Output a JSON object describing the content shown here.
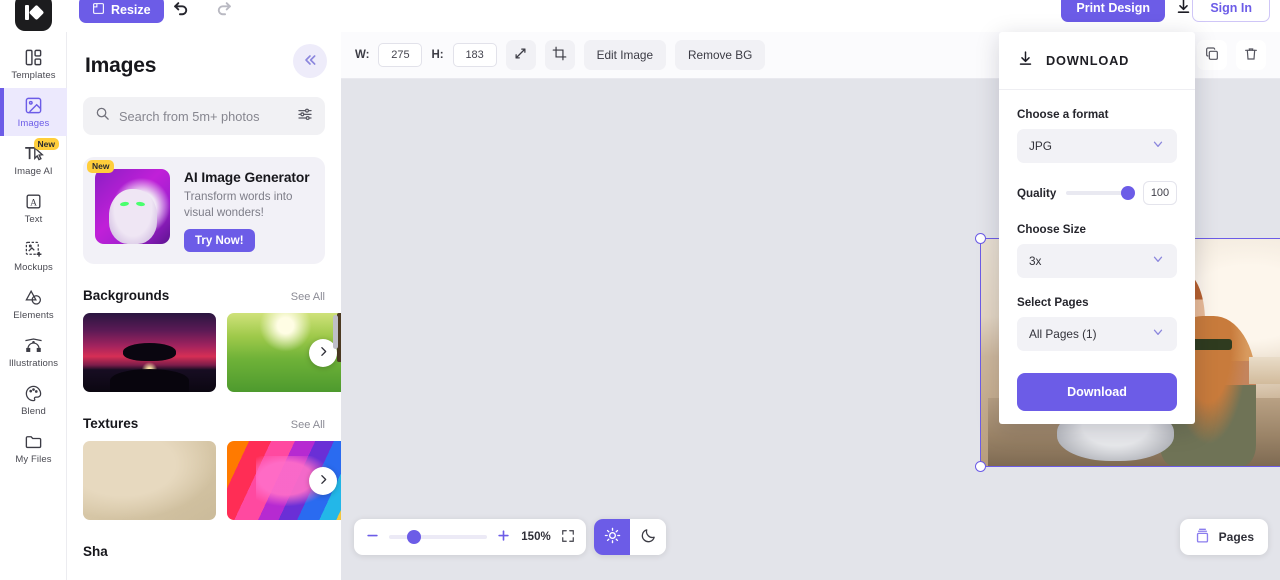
{
  "header": {
    "logo_name": "app-logo",
    "resize_label": "Resize",
    "undo_icon": "undo-arrow-icon",
    "redo_icon": "redo-arrow-icon",
    "print_label": "Print Design",
    "download_icon": "download-icon",
    "signin_label": "Sign In"
  },
  "rail": {
    "items": [
      {
        "label": "Templates",
        "icon": "templates-grid-icon",
        "active": false,
        "badge": ""
      },
      {
        "label": "Images",
        "icon": "image-photo-icon",
        "active": true,
        "badge": ""
      },
      {
        "label": "Image AI",
        "icon": "text-cursor-ai-icon",
        "active": false,
        "badge": "New"
      },
      {
        "label": "Text",
        "icon": "letter-a-box-icon",
        "active": false,
        "badge": ""
      },
      {
        "label": "Mockups",
        "icon": "mockup-frame-icon",
        "active": false,
        "badge": ""
      },
      {
        "label": "Elements",
        "icon": "elements-shape-icon",
        "active": false,
        "badge": ""
      },
      {
        "label": "Illustrations",
        "icon": "illustration-nodes-icon",
        "active": false,
        "badge": ""
      },
      {
        "label": "Blend",
        "icon": "palette-icon",
        "active": false,
        "badge": ""
      },
      {
        "label": "My Files",
        "icon": "folder-icon",
        "active": false,
        "badge": ""
      }
    ]
  },
  "panel": {
    "title": "Images",
    "collapse_icon": "chevron-double-left-icon",
    "search": {
      "placeholder": "Search from 5m+ photos",
      "value": "",
      "search_icon": "search-icon",
      "filter_icon": "sliders-filter-icon"
    },
    "promo": {
      "badge": "New",
      "title": "AI Image Generator",
      "subtitle": "Transform words into visual wonders!",
      "cta": "Try Now!",
      "thumb_name": "ai-monster-thumbnail"
    },
    "sections": [
      {
        "title": "Backgrounds",
        "see_all": "See All",
        "tiles": [
          "sunset-tree-silhouette",
          "sunlit-green-meadow"
        ]
      },
      {
        "title": "Textures",
        "see_all": "See All",
        "tiles": [
          "beige-paper-texture",
          "rainbow-paint-strokes"
        ]
      }
    ],
    "cut_section_title": "Sha"
  },
  "toolbar": {
    "width_label": "W:",
    "width_value": "275",
    "height_label": "H:",
    "height_value": "183",
    "resize_icon": "scale-diagonal-icon",
    "crop_icon": "crop-icon",
    "edit_image_label": "Edit Image",
    "remove_bg_label": "Remove BG",
    "position_icon": "position-grid-icon",
    "duplicate_icon": "duplicate-copy-icon",
    "delete_icon": "trash-delete-icon"
  },
  "canvas": {
    "selected_object": "group-beach-selfie-photo"
  },
  "download_panel": {
    "header_icon": "download-icon",
    "header_title": "DOWNLOAD",
    "format_label": "Choose a format",
    "format_value": "JPG",
    "quality_label": "Quality",
    "quality_value": "100",
    "size_label": "Choose Size",
    "size_value": "3x",
    "pages_label": "Select Pages",
    "pages_value": "All Pages (1)",
    "download_button": "Download",
    "chevron_icon": "chevron-down-icon"
  },
  "bottom_bar": {
    "minus_icon": "minus-icon",
    "plus_icon": "plus-icon",
    "zoom_level": "150%",
    "fit_icon": "fit-screen-icon",
    "light_icon": "sun-icon",
    "dark_icon": "moon-icon",
    "pages_icon": "pages-stack-icon",
    "pages_label": "Pages"
  },
  "colors": {
    "accent": "#6C5CE7",
    "badge_yellow": "#FFCE3B",
    "canvas_bg": "#E3E4EA",
    "panel_bg": "#FFFFFF",
    "field_bg": "#F2F2F6"
  }
}
